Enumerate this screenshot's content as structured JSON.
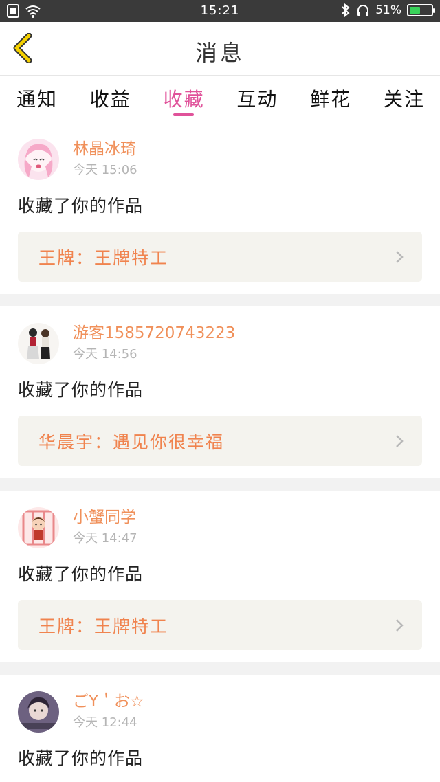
{
  "status_bar": {
    "time": "15:21",
    "battery_text": "51%",
    "battery_level": 0.51
  },
  "header": {
    "title": "消息"
  },
  "tabs": [
    {
      "label": "通知"
    },
    {
      "label": "收益"
    },
    {
      "label": "收藏",
      "active": true
    },
    {
      "label": "互动"
    },
    {
      "label": "鲜花"
    },
    {
      "label": "关注"
    }
  ],
  "messages": [
    {
      "username": "林晶冰琦",
      "time": "今天 15:06",
      "action": "收藏了你的作品",
      "work": "王牌：王牌特工"
    },
    {
      "username": "游客1585720743223",
      "time": "今天 14:56",
      "action": "收藏了你的作品",
      "work": "华晨宇：遇见你很幸福"
    },
    {
      "username": "小蟹同学",
      "time": "今天 14:47",
      "action": "收藏了你的作品",
      "work": "王牌：王牌特工"
    },
    {
      "username": "ごY＇お☆",
      "time": "今天 12:44",
      "action": "收藏了你的作品"
    }
  ],
  "colors": {
    "accent": "#e0529a",
    "username": "#f0905a",
    "work_title": "#f0834e",
    "back_arrow": "#f5d100"
  }
}
